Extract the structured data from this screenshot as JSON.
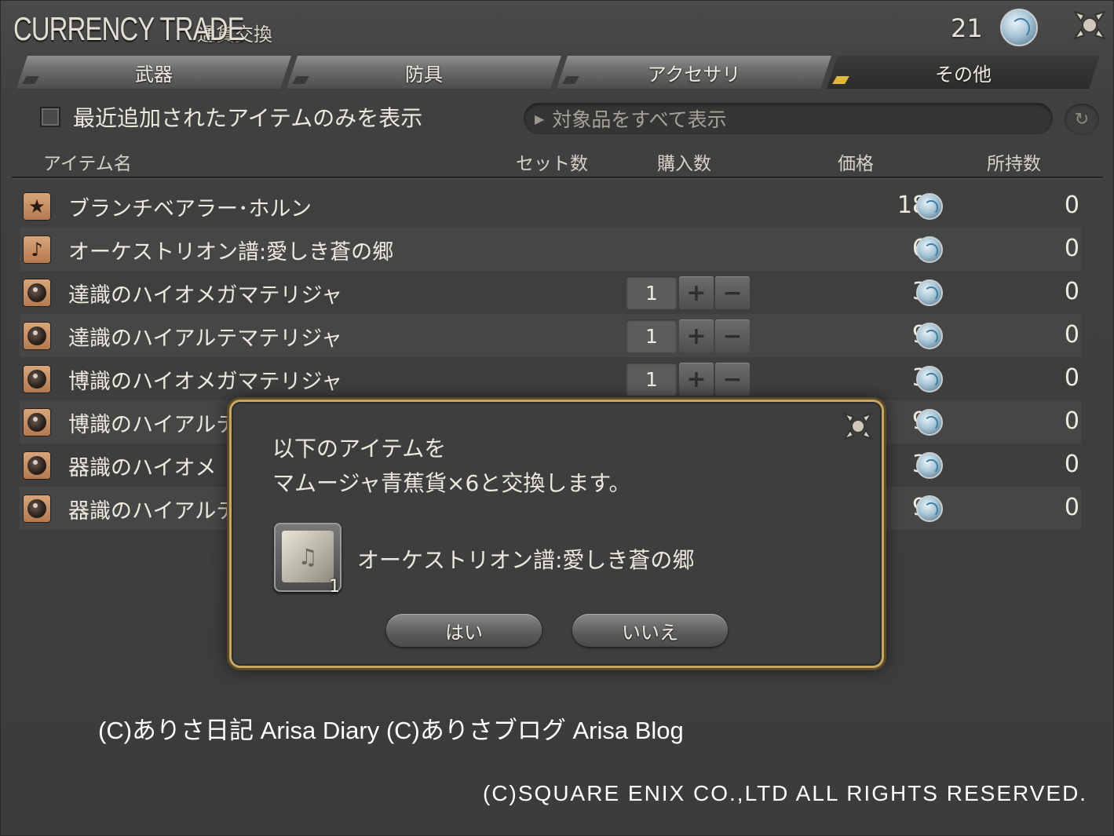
{
  "window": {
    "title": "CURRENCY TRADE",
    "subtitle": "通貨交換",
    "currency_count": "21",
    "currency_icon": "blue-coin-icon",
    "close_icon": "close-icon"
  },
  "tabs": [
    {
      "label": "武器",
      "active": false
    },
    {
      "label": "防具",
      "active": false
    },
    {
      "label": "アクセサリ",
      "active": false
    },
    {
      "label": "その他",
      "active": true
    }
  ],
  "filter": {
    "checkbox_label": "最近追加されたアイテムのみを表示",
    "checked": false,
    "dropdown_value": "対象品をすべて表示",
    "dropdown_arrow": "▶",
    "refresh_icon": "refresh-icon",
    "refresh_glyph": "↻"
  },
  "columns": {
    "name": "アイテム名",
    "set_count": "セット数",
    "purchase_count": "購入数",
    "price": "価格",
    "owned": "所持数"
  },
  "rows": [
    {
      "icon": "star-icon",
      "glyph": "★",
      "name": "ブランチベアラー･ホルン",
      "qty": "",
      "price": "18",
      "owned": "0"
    },
    {
      "icon": "music-note-icon",
      "glyph": "♪",
      "name": "オーケストリオン譜:愛しき蒼の郷",
      "qty": "",
      "price": "6",
      "owned": "0"
    },
    {
      "icon": "materia-icon",
      "glyph": "",
      "name": "達識のハイオメガマテリジャ",
      "qty": "1",
      "price": "3",
      "owned": "0"
    },
    {
      "icon": "materia-icon",
      "glyph": "",
      "name": "達識のハイアルテマテリジャ",
      "qty": "1",
      "price": "9",
      "owned": "0"
    },
    {
      "icon": "materia-icon",
      "glyph": "",
      "name": "博識のハイオメガマテリジャ",
      "qty": "1",
      "price": "3",
      "owned": "0"
    },
    {
      "icon": "materia-icon",
      "glyph": "",
      "name": "博識のハイアルテ",
      "qty": "",
      "price": "9",
      "owned": "0"
    },
    {
      "icon": "materia-icon",
      "glyph": "",
      "name": "器識のハイオメ",
      "qty": "",
      "price": "3",
      "owned": "0"
    },
    {
      "icon": "materia-icon",
      "glyph": "",
      "name": "器識のハイアルテ",
      "qty": "",
      "price": "9",
      "owned": "0"
    }
  ],
  "stepper": {
    "plus": "+",
    "minus": "−"
  },
  "dialog": {
    "line1": "以下のアイテムを",
    "line2": "マムージャ青蕉貨×6と交換します。",
    "item_name": "オーケストリオン譜:愛しき蒼の郷",
    "item_count": "1",
    "item_icon": "orchestrion-roll-icon",
    "item_glyph": "♫",
    "yes_label": "はい",
    "no_label": "いいえ"
  },
  "overlay": {
    "watermark": "(C)ありさ日記 Arisa Diary (C)ありさブログ Arisa Blog",
    "copyright": "(C)SQUARE ENIX CO.,LTD ALL RIGHTS RESERVED."
  },
  "colors": {
    "window_bg": "#3d3d3d",
    "dialog_border": "#c8a765",
    "active_tab_marker": "#e0b93a",
    "item_icon_bg": "#d9a77b"
  }
}
